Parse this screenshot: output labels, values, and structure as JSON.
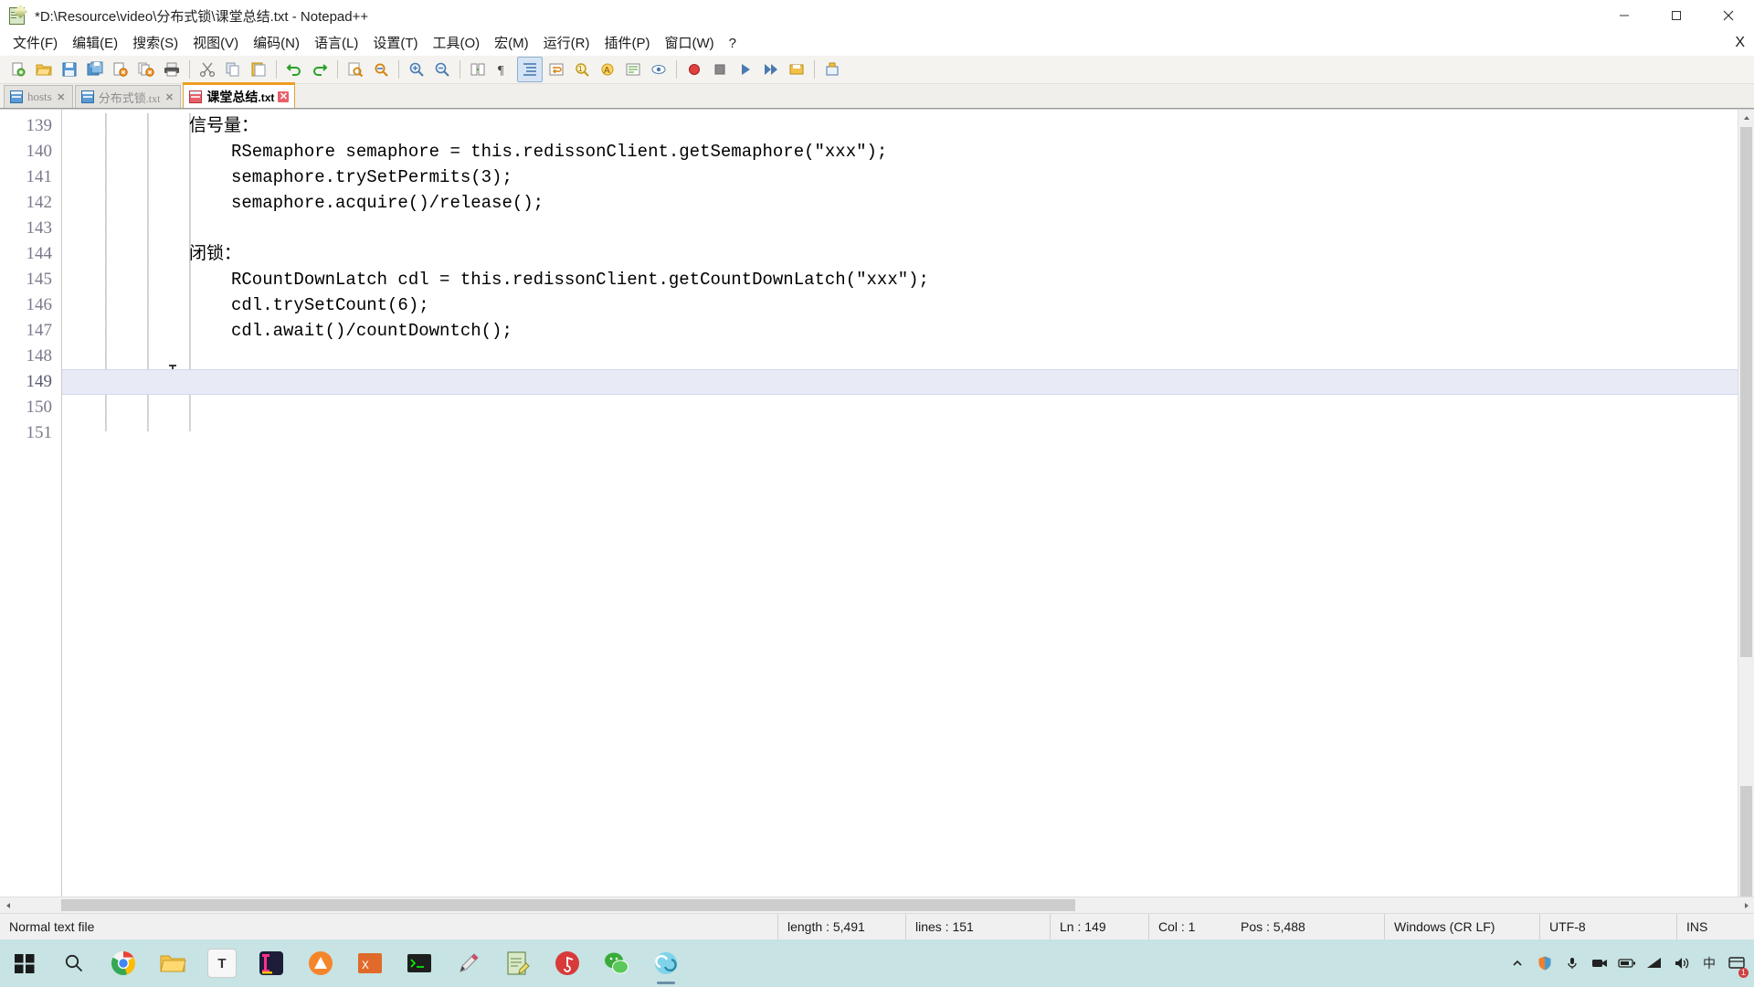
{
  "window": {
    "title": "*D:\\Resource\\video\\分布式锁\\课堂总结.txt - Notepad++",
    "icon": "notepadpp-icon",
    "minimize_label": "–",
    "maximize_label": "□",
    "close_label": "✕"
  },
  "menubar": {
    "items": [
      {
        "label": "文件(F)",
        "name": "menu-file"
      },
      {
        "label": "编辑(E)",
        "name": "menu-edit"
      },
      {
        "label": "搜索(S)",
        "name": "menu-search"
      },
      {
        "label": "视图(V)",
        "name": "menu-view"
      },
      {
        "label": "编码(N)",
        "name": "menu-encoding"
      },
      {
        "label": "语言(L)",
        "name": "menu-language"
      },
      {
        "label": "设置(T)",
        "name": "menu-settings"
      },
      {
        "label": "工具(O)",
        "name": "menu-tools"
      },
      {
        "label": "宏(M)",
        "name": "menu-macro"
      },
      {
        "label": "运行(R)",
        "name": "menu-run"
      },
      {
        "label": "插件(P)",
        "name": "menu-plugins"
      },
      {
        "label": "窗口(W)",
        "name": "menu-window"
      },
      {
        "label": "?",
        "name": "menu-help"
      }
    ],
    "close_doc_label": "X"
  },
  "tabs": [
    {
      "label": "hosts",
      "ext": "",
      "active": false,
      "name": "tab-hosts",
      "close_label": "✕"
    },
    {
      "label": "分布式锁",
      "ext": ".txt",
      "active": false,
      "name": "tab-distributed-lock",
      "close_label": "✕"
    },
    {
      "label": "课堂总结",
      "ext": ".txt",
      "active": true,
      "name": "tab-class-summary",
      "close_label": "✕"
    }
  ],
  "editor": {
    "first_line_number": 139,
    "lines": [
      {
        "num": "139",
        "text": "信号量：",
        "cjk": true,
        "indent": 0
      },
      {
        "num": "140",
        "text": "RSemaphore semaphore = this.redissonClient.getSemaphore(\"xxx\");",
        "cjk": false,
        "indent": 1
      },
      {
        "num": "141",
        "text": "semaphore.trySetPermits(3);",
        "cjk": false,
        "indent": 1
      },
      {
        "num": "142",
        "text": "semaphore.acquire()/release();",
        "cjk": false,
        "indent": 1
      },
      {
        "num": "143",
        "text": "",
        "cjk": false,
        "indent": 0
      },
      {
        "num": "144",
        "text": "闭锁：",
        "cjk": true,
        "indent": 0
      },
      {
        "num": "145",
        "text": "RCountDownLatch cdl = this.redissonClient.getCountDownLatch(\"xxx\");",
        "cjk": false,
        "indent": 1
      },
      {
        "num": "146",
        "text": "cdl.trySetCount(6);",
        "cjk": false,
        "indent": 1
      },
      {
        "num": "147",
        "text": "cdl.await()/countDowntch();",
        "cjk": false,
        "indent": 1
      },
      {
        "num": "148",
        "text": "",
        "cjk": false,
        "indent": 0
      },
      {
        "num": "149",
        "text": "",
        "cjk": false,
        "indent": 0,
        "current": true
      },
      {
        "num": "150",
        "text": "",
        "cjk": false,
        "indent": 0
      },
      {
        "num": "151",
        "text": "",
        "cjk": false,
        "indent": 0
      }
    ]
  },
  "statusbar": {
    "file_type": "Normal text file",
    "length": "length : 5,491",
    "lines": "lines : 151",
    "ln": "Ln : 149",
    "col": "Col : 1",
    "pos": "Pos : 5,488",
    "eol": "Windows (CR LF)",
    "encoding": "UTF-8",
    "insert_mode": "INS"
  },
  "taskbar": {
    "start_label": "⊞",
    "search_label": "search-icon",
    "apps": [
      {
        "name": "taskbar-chrome",
        "glyph": "",
        "color": "#e8e8e8",
        "running": false
      },
      {
        "name": "taskbar-file-explorer",
        "glyph": "",
        "color": "#ffc75a",
        "running": false
      },
      {
        "name": "taskbar-typora",
        "glyph": "T",
        "color": "#ffffff",
        "running": false
      },
      {
        "name": "taskbar-idea",
        "glyph": "",
        "color": "#2b2b4a",
        "running": false
      },
      {
        "name": "taskbar-navicat",
        "glyph": "",
        "color": "#f5852a",
        "running": false
      },
      {
        "name": "taskbar-xshell",
        "glyph": "",
        "color": "#e06a2a",
        "running": false
      },
      {
        "name": "taskbar-terminal",
        "glyph": "",
        "color": "#2a2a2a",
        "running": false
      },
      {
        "name": "taskbar-editor",
        "glyph": "",
        "color": "#f0f0f0",
        "running": false
      },
      {
        "name": "taskbar-notepad",
        "glyph": "",
        "color": "#d8e8c8",
        "running": false
      },
      {
        "name": "taskbar-music",
        "glyph": "",
        "color": "#d83a3a",
        "running": false
      },
      {
        "name": "taskbar-wechat",
        "glyph": "",
        "color": "#3aab3a",
        "running": false
      },
      {
        "name": "taskbar-notepadpp",
        "glyph": "",
        "color": "#8ad0e8",
        "running": true
      }
    ],
    "tray": [
      {
        "name": "tray-show-hidden-icons",
        "glyph": "⌃"
      },
      {
        "name": "tray-security-icon",
        "glyph": "⛨"
      },
      {
        "name": "tray-microphone-icon",
        "glyph": "♉"
      },
      {
        "name": "tray-camera-icon",
        "glyph": "▣"
      },
      {
        "name": "tray-battery-icon",
        "glyph": "▭"
      },
      {
        "name": "tray-network-icon",
        "glyph": "◰"
      },
      {
        "name": "tray-volume-icon",
        "glyph": "ὐa"
      },
      {
        "name": "tray-ime-icon",
        "glyph": "中"
      },
      {
        "name": "tray-notifications-icon",
        "glyph": "☷",
        "badge": "1"
      }
    ]
  },
  "colors": {
    "tab_active_accent": "#ef9d20",
    "titlebar_bg": "#ffffff",
    "toolbar_bg": "#f4f3ef",
    "editor_bg": "#ffffff",
    "current_line": "#e8eaf6",
    "taskbar_bg": "#c7e3e3",
    "gutter_text": "#7a7a8c"
  }
}
